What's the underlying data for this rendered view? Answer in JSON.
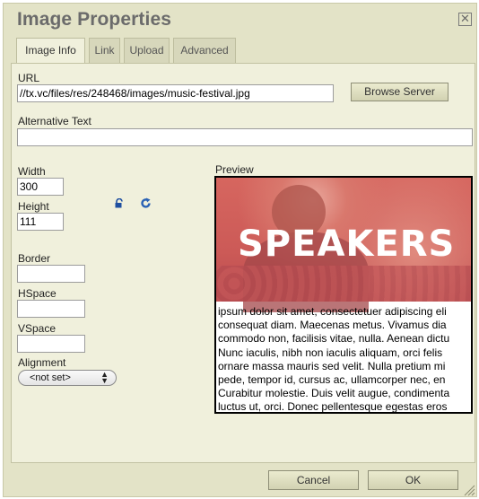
{
  "dialog": {
    "title": "Image Properties",
    "close_glyph": "☒"
  },
  "tabs": [
    {
      "label": "Image Info",
      "active": true
    },
    {
      "label": "Link",
      "active": false
    },
    {
      "label": "Upload",
      "active": false
    },
    {
      "label": "Advanced",
      "active": false
    }
  ],
  "url": {
    "label": "URL",
    "value": "//tx.vc/files/res/248468/images/music-festival.jpg",
    "browse_label": "Browse Server"
  },
  "alt_text": {
    "label": "Alternative Text",
    "value": ""
  },
  "dimensions": {
    "width_label": "Width",
    "width_value": "300",
    "height_label": "Height",
    "height_value": "111",
    "lock_icon": "lock-icon",
    "reset_icon": "reset-size-icon"
  },
  "border": {
    "label": "Border",
    "value": ""
  },
  "hspace": {
    "label": "HSpace",
    "value": ""
  },
  "vspace": {
    "label": "VSpace",
    "value": ""
  },
  "alignment": {
    "label": "Alignment",
    "value": "<not set>"
  },
  "preview": {
    "label": "Preview",
    "banner_text": "SPEAKERS",
    "lines": [
      "ipsum dolor sit amet, consectetuer adipiscing eli",
      "consequat diam. Maecenas metus. Vivamus dia",
      "commodo non, facilisis vitae, nulla. Aenean dictu",
      "Nunc iaculis, nibh non iaculis aliquam, orci felis",
      "ornare massa mauris sed velit. Nulla pretium mi",
      "pede, tempor id, cursus ac, ullamcorper nec, en",
      "Curabitur molestie. Duis velit augue, condimenta",
      "luctus ut, orci. Donec pellentesque egestas eros"
    ]
  },
  "footer": {
    "cancel_label": "Cancel",
    "ok_label": "OK"
  },
  "colors": {
    "dialog_bg": "#e3e3c7",
    "panel_bg": "#f0f0dc",
    "reset_icon": "#2a62b5",
    "lock_icon": "#1f4fa0"
  }
}
